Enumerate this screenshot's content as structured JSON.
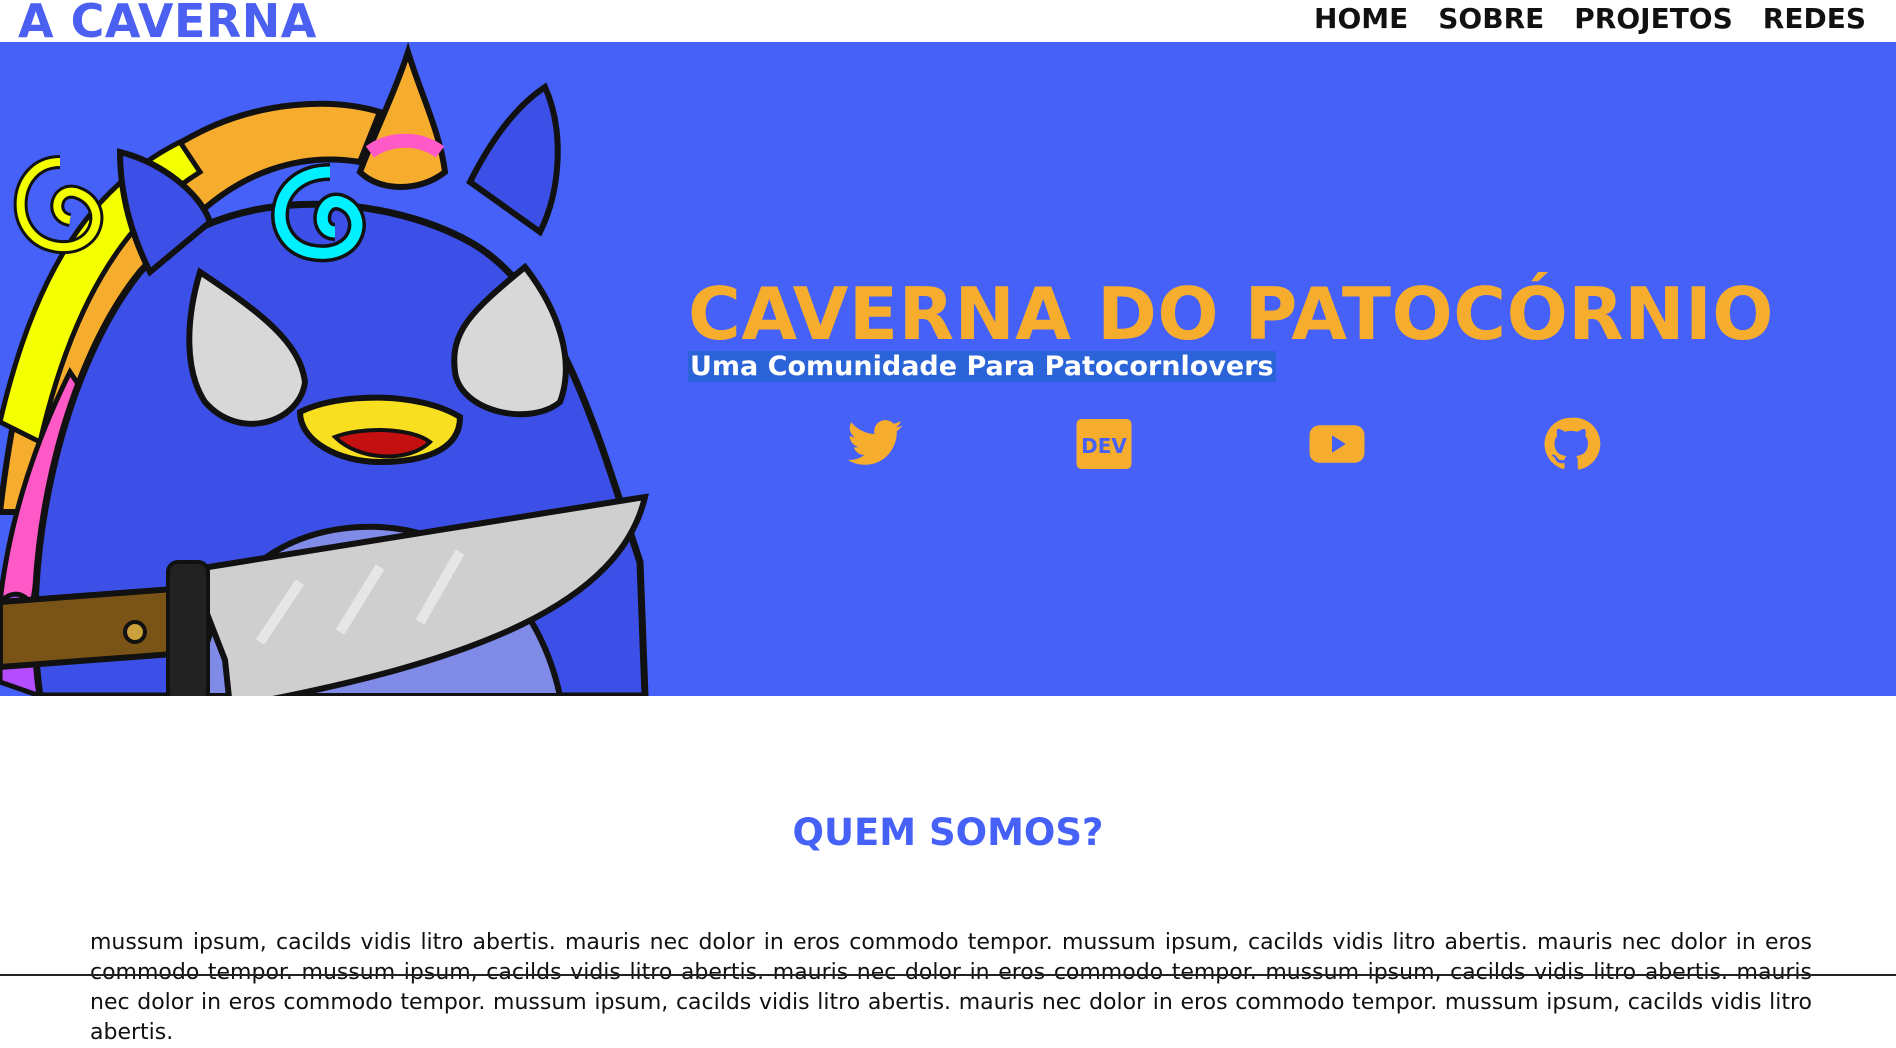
{
  "header": {
    "brand": "A CAVERNA",
    "nav": [
      "HOME",
      "SOBRE",
      "PROJETOS",
      "REDES"
    ]
  },
  "hero": {
    "title": "CAVERNA DO PATOCÓRNIO",
    "subtitle": "Uma Comunidade Para Patocornlovers",
    "social_icons": [
      "twitter-icon",
      "dev-icon",
      "youtube-icon",
      "github-icon"
    ],
    "dev_label": "DEV"
  },
  "about": {
    "title": "QUEM SOMOS?",
    "text": "mussum ipsum, cacilds vidis litro abertis. mauris nec dolor in eros commodo tempor. mussum ipsum, cacilds vidis litro abertis. mauris nec dolor in eros commodo tempor. mussum ipsum, cacilds vidis litro abertis. mauris nec dolor in eros commodo tempor. mussum ipsum, cacilds vidis litro abertis. mauris nec dolor in eros commodo tempor. mussum ipsum, cacilds vidis litro abertis. mauris nec dolor in eros commodo tempor. mussum ipsum, cacilds vidis litro abertis."
  },
  "colors": {
    "brand_blue": "#4561f8",
    "accent_orange": "#f6ad2e",
    "subtitle_highlight": "#2b63d9"
  }
}
